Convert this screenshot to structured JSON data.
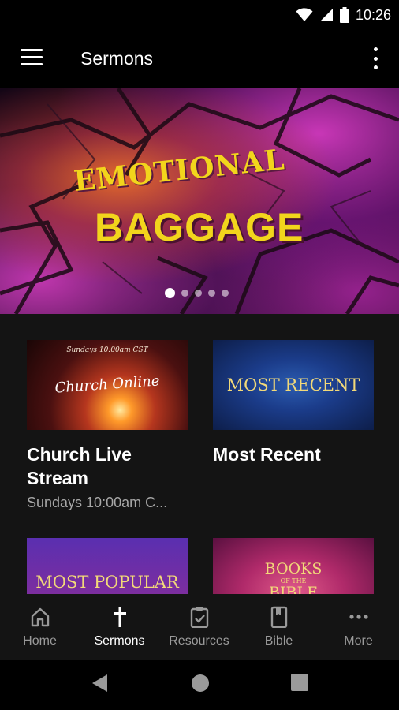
{
  "status_bar": {
    "time": "10:26"
  },
  "app_bar": {
    "title": "Sermons"
  },
  "hero": {
    "title_small": "EMOTIONAL",
    "title_big": "BAGGAGE",
    "slide_count": 5,
    "active_slide": 1
  },
  "cards": [
    {
      "title": "Church Live Stream",
      "subtitle": "Sundays 10:00am C...",
      "thumb_top_text": "Sundays 10:00am CST",
      "thumb_text": "Church Online"
    },
    {
      "title": "Most Recent",
      "subtitle": "",
      "thumb_text": "MOST RECENT"
    },
    {
      "title": "",
      "subtitle": "",
      "thumb_text": "MOST POPULAR"
    },
    {
      "title": "",
      "subtitle": "",
      "thumb_text_line1": "BOOKS",
      "thumb_text_line2": "OF THE",
      "thumb_text_line3": "BIBLE"
    }
  ],
  "bottom_nav": [
    {
      "label": "Home",
      "icon": "home-icon",
      "active": false
    },
    {
      "label": "Sermons",
      "icon": "cross-icon",
      "active": true
    },
    {
      "label": "Resources",
      "icon": "clipboard-check-icon",
      "active": false
    },
    {
      "label": "Bible",
      "icon": "book-icon",
      "active": false
    },
    {
      "label": "More",
      "icon": "more-horizontal-icon",
      "active": false
    }
  ],
  "colors": {
    "accent_yellow": "#f2d51c",
    "background": "#141414",
    "bar": "#000000",
    "muted_text": "#a7a7a7"
  }
}
